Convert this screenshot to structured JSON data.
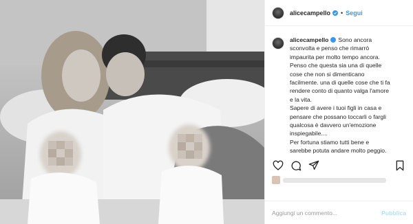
{
  "post": {
    "username": "alicecampello",
    "follow_label": "Segui",
    "separator": "•",
    "caption_lines": [
      "Sono ancora",
      "sconvolta e penso che rimarrò",
      "impaurita per molto tempo ancora.",
      "Penso che questa sia una di quelle",
      "cose che non si dimenticano",
      "facilmente. una di quelle cose che ti fa",
      "rendere conto di quanto valga l'amore",
      "e la vita.",
      "Sapere di avere i tuoi figli in casa e",
      "pensare che possano toccarli o fargli",
      "qualcosa è davvero un'emozione",
      "inspiegabile....",
      "Per fortuna stiamo tutti bene e",
      "sarebbe potuta andare molto peggio."
    ]
  },
  "actions": {
    "icons": [
      "heart-icon",
      "comment-icon",
      "share-icon",
      "bookmark-icon"
    ]
  },
  "comment": {
    "placeholder": "Aggiungi un commento...",
    "publish_label": "Pubblica"
  },
  "colors": {
    "link_blue": "#3897f0",
    "publish_disabled": "#b2dffc",
    "text": "#262626",
    "placeholder": "#999999"
  }
}
